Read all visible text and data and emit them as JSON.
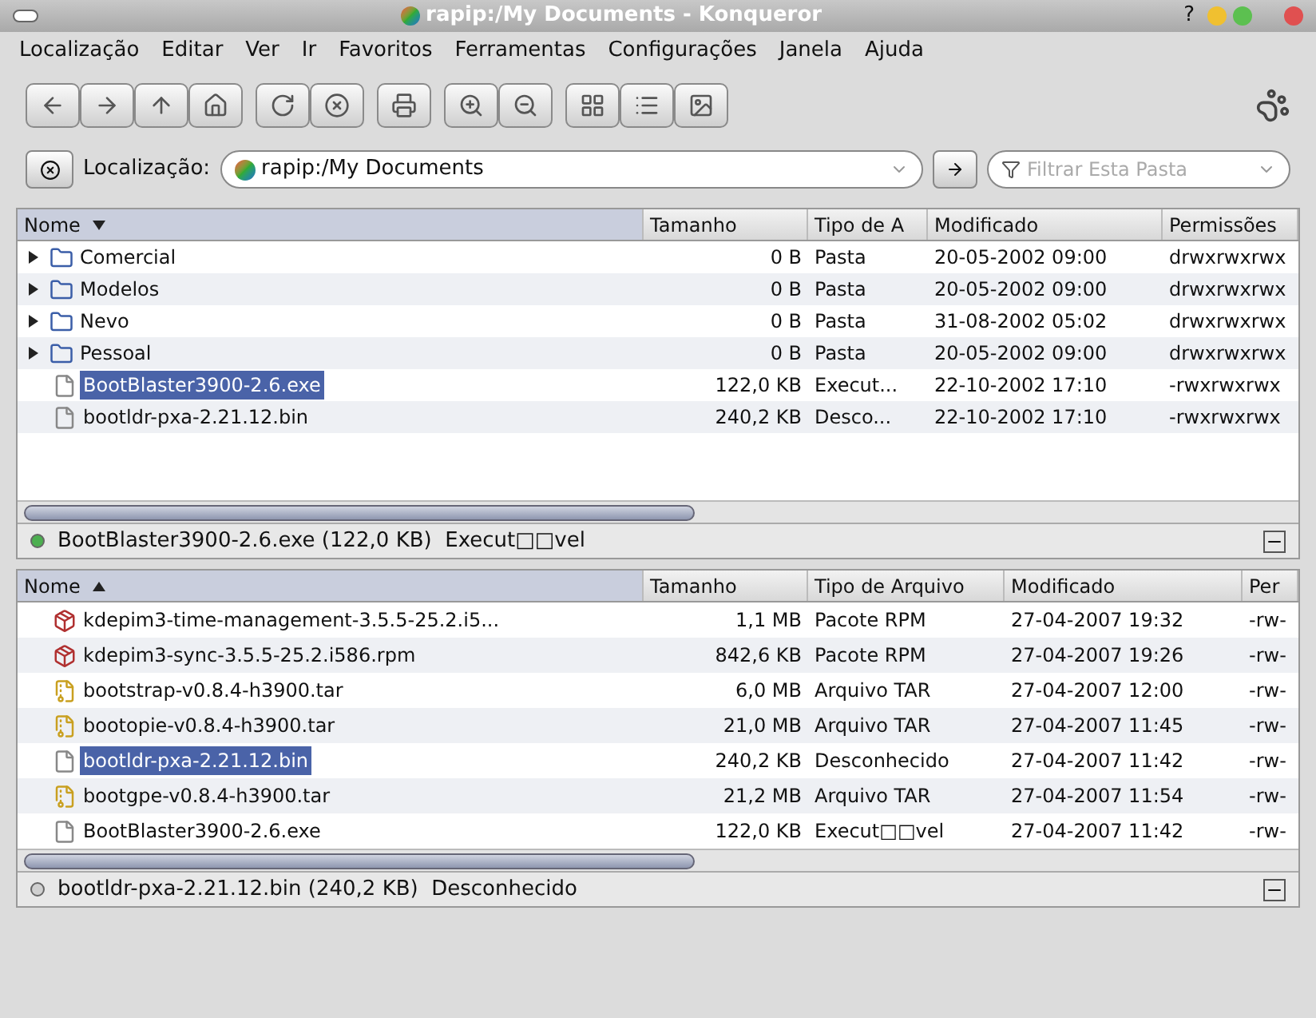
{
  "window": {
    "title": "rapip:/My Documents - Konqueror",
    "help": "?"
  },
  "menu": [
    "Localização",
    "Editar",
    "Ver",
    "Ir",
    "Favoritos",
    "Ferramentas",
    "Configurações",
    "Janela",
    "Ajuda"
  ],
  "location": {
    "label": "Localização:",
    "value": "rapip:/My Documents",
    "filter_placeholder": "Filtrar Esta Pasta"
  },
  "panels": [
    {
      "sort_descending": true,
      "columns": [
        {
          "label": "Nome",
          "sorted": true
        },
        {
          "label": "Tamanho",
          "sorted": false
        },
        {
          "label": "Tipo de A",
          "sorted": false
        },
        {
          "label": "Modificado",
          "sorted": false
        },
        {
          "label": "Permissões",
          "sorted": false
        }
      ],
      "rows": [
        {
          "kind": "folder",
          "expanded": false,
          "selected": false,
          "cells": [
            "Comercial",
            "0 B",
            "Pasta",
            "20-05-2002 09:00",
            "drwxrwxrwx"
          ]
        },
        {
          "kind": "folder",
          "expanded": false,
          "selected": false,
          "cells": [
            "Modelos",
            "0 B",
            "Pasta",
            "20-05-2002 09:00",
            "drwxrwxrwx"
          ]
        },
        {
          "kind": "folder",
          "expanded": false,
          "selected": false,
          "cells": [
            "Nevo",
            "0 B",
            "Pasta",
            "31-08-2002 05:02",
            "drwxrwxrwx"
          ]
        },
        {
          "kind": "folder",
          "expanded": false,
          "selected": false,
          "cells": [
            "Pessoal",
            "0 B",
            "Pasta",
            "20-05-2002 09:00",
            "drwxrwxrwx"
          ]
        },
        {
          "kind": "file",
          "selected": true,
          "cells": [
            "BootBlaster3900-2.6.exe",
            "122,0 KB",
            "Execut...",
            "22-10-2002 17:10",
            "-rwxrwxrwx"
          ]
        },
        {
          "kind": "file",
          "selected": false,
          "cells": [
            "bootldr-pxa-2.21.12.bin",
            "240,2 KB",
            "Desco...",
            "22-10-2002 17:10",
            "-rwxrwxrwx"
          ]
        }
      ],
      "status": "BootBlaster3900-2.6.exe (122,0 KB)  Execut□□vel",
      "active": true
    },
    {
      "sort_descending": false,
      "columns": [
        {
          "label": "Nome",
          "sorted": true
        },
        {
          "label": "Tamanho",
          "sorted": false
        },
        {
          "label": "Tipo de Arquivo",
          "sorted": false
        },
        {
          "label": "Modificado",
          "sorted": false
        },
        {
          "label": "Per",
          "sorted": false
        }
      ],
      "rows": [
        {
          "kind": "rpm",
          "selected": false,
          "cells": [
            "kdepim3-time-management-3.5.5-25.2.i5...",
            "1,1 MB",
            "Pacote RPM",
            "27-04-2007 19:32",
            "-rw-"
          ]
        },
        {
          "kind": "rpm",
          "selected": false,
          "cells": [
            "kdepim3-sync-3.5.5-25.2.i586.rpm",
            "842,6 KB",
            "Pacote RPM",
            "27-04-2007 19:26",
            "-rw-"
          ]
        },
        {
          "kind": "tar",
          "selected": false,
          "cells": [
            "bootstrap-v0.8.4-h3900.tar",
            "6,0 MB",
            "Arquivo TAR",
            "27-04-2007 12:00",
            "-rw-"
          ]
        },
        {
          "kind": "tar",
          "selected": false,
          "cells": [
            "bootopie-v0.8.4-h3900.tar",
            "21,0 MB",
            "Arquivo TAR",
            "27-04-2007 11:45",
            "-rw-"
          ]
        },
        {
          "kind": "file",
          "selected": true,
          "cells": [
            "bootldr-pxa-2.21.12.bin",
            "240,2 KB",
            "Desconhecido",
            "27-04-2007 11:42",
            "-rw-"
          ]
        },
        {
          "kind": "tar",
          "selected": false,
          "cells": [
            "bootgpe-v0.8.4-h3900.tar",
            "21,2 MB",
            "Arquivo TAR",
            "27-04-2007 11:54",
            "-rw-"
          ]
        },
        {
          "kind": "file",
          "selected": false,
          "cells": [
            "BootBlaster3900-2.6.exe",
            "122,0 KB",
            "Execut□□vel",
            "27-04-2007 11:42",
            "-rw-"
          ]
        }
      ],
      "status": "bootldr-pxa-2.21.12.bin (240,2 KB)  Desconhecido",
      "active": false
    }
  ]
}
